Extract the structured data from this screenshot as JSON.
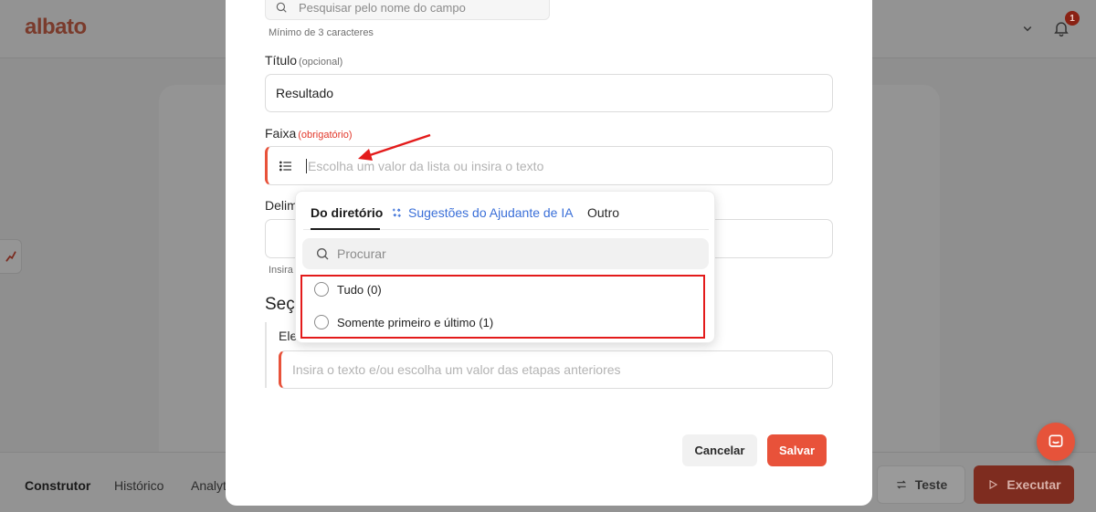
{
  "app": {
    "logo": "albato",
    "notifications_count": "1"
  },
  "bottom_tabs": [
    "Construtor",
    "Histórico",
    "Analyt"
  ],
  "actions": {
    "test_label": "Teste",
    "run_label": "Executar"
  },
  "modal": {
    "field_search": {
      "placeholder": "Pesquisar pelo nome do campo",
      "helper": "Mínimo de 3 caracteres"
    },
    "title_field": {
      "label": "Título",
      "qualifier": "(opcional)",
      "value": "Resultado"
    },
    "range_field": {
      "label": "Faixa",
      "qualifier": "(obrigatório)",
      "placeholder": "Escolha um valor da lista ou insira o texto"
    },
    "delimiter_field": {
      "label_partial": "Delim",
      "helper_partial": "Insira"
    },
    "section": {
      "title_partial": "Seç",
      "element_label_partial": "Ele",
      "input_placeholder": "Insira o texto e/ou escolha um valor das etapas anteriores"
    },
    "cancel_label": "Cancelar",
    "save_label": "Salvar"
  },
  "dropdown": {
    "tabs": [
      {
        "label": "Do diretório",
        "active": true
      },
      {
        "label": "Sugestões do Ajudante de IA",
        "active": false
      },
      {
        "label": "Outro",
        "active": false
      }
    ],
    "search_placeholder": "Procurar",
    "options": [
      {
        "label": "Tudo (0)"
      },
      {
        "label": "Somente primeiro e último (1)"
      }
    ]
  },
  "colors": {
    "accent": "#e8523a",
    "highlight_box": "#e31b1b",
    "ai_link": "#3a6fd8"
  }
}
